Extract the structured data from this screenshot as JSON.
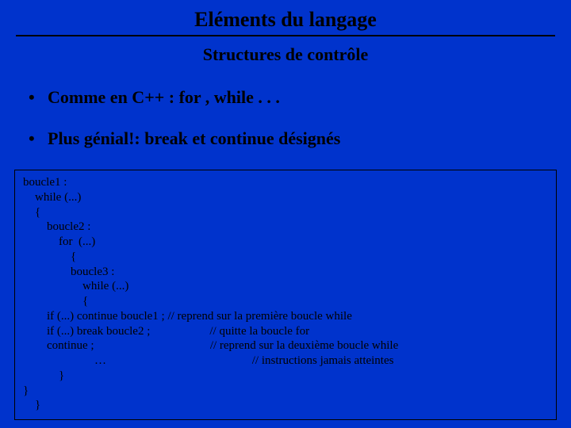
{
  "title": "Eléments du langage",
  "subtitle": "Structures de contrôle",
  "bullets": [
    "Comme en C++ : for , while . . .",
    "Plus génial!: break et continue désignés"
  ],
  "code": "boucle1 :\n    while (...)\n    {\n        boucle2 :\n            for  (...)\n                {\n                boucle3 :\n                    while (...)\n                    {\n        if (...) continue boucle1 ; // reprend sur la première boucle while\n        if (...) break boucle2 ;                    // quitte la boucle for\n        continue ;                                       // reprend sur la deuxième boucle while\n                        …                                                 // instructions jamais atteintes\n            }\n}\n    }"
}
